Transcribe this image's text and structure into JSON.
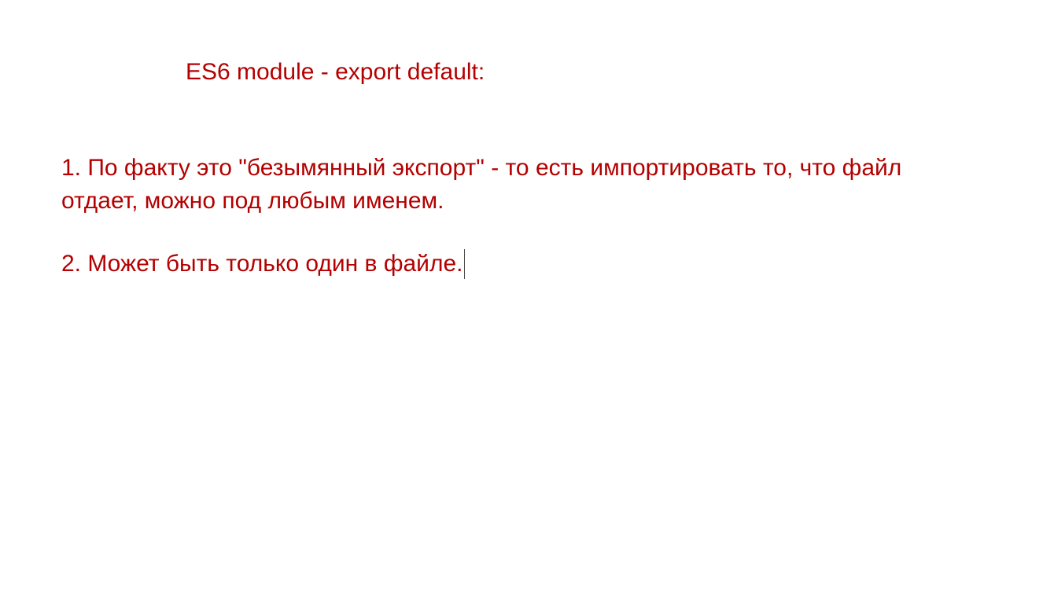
{
  "slide": {
    "title": "ES6 module - export default:",
    "items": [
      {
        "line1": "1. По факту это \"безымянный экспорт\" - то есть импортировать то, что файл",
        "line2": "отдает, можно под любым именем."
      },
      {
        "text": "2. Может быть только один в файле."
      }
    ],
    "text_color": "#b40000"
  }
}
